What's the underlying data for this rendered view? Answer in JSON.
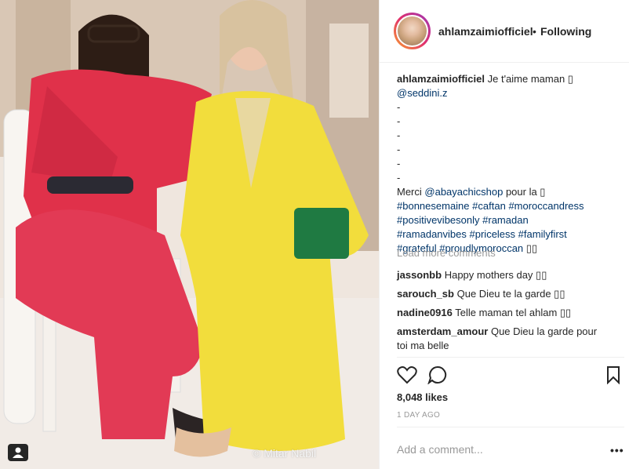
{
  "post": {
    "username": "ahlamzaimiofficiel",
    "separator": "•",
    "follow_status": "Following",
    "caption": {
      "username": "ahlamzaimiofficiel",
      "text_line1": "Je t'aime maman ▯",
      "mention1": "@seddini.z",
      "dashes": [
        "-",
        "-",
        "-",
        "-",
        "-",
        "-"
      ],
      "merci_pre": "Merci ",
      "mention2": "@abayachicshop",
      "merci_post": " pour la ▯",
      "hashtags": [
        "#bonnesemaine",
        "#caftan",
        "#moroccandress",
        "#positivevibesonly",
        "#ramadan",
        "#ramadanvibes",
        "#priceless",
        "#familyfirst",
        "#grateful",
        "#proudlymoroccan"
      ],
      "end": "▯▯"
    },
    "load_more": "Load more comments",
    "comments": [
      {
        "user": "jassonbb",
        "text": "Happy mothers day ▯▯"
      },
      {
        "user": "sarouch_sb",
        "text": "Que Dieu te la garde ▯▯"
      },
      {
        "user": "nadine0916",
        "text": "Telle maman tel ahlam ▯▯"
      },
      {
        "user": "amsterdam_amour",
        "text": "Que Dieu la garde pour toi ma belle"
      }
    ],
    "likes": "8,048 likes",
    "time": "1 DAY AGO",
    "add_comment_placeholder": "Add a comment...",
    "more_label": "•••",
    "watermark": "© Mitar Nabil"
  },
  "icons": {
    "like": "heart-icon",
    "comment": "comment-icon",
    "save": "bookmark-icon",
    "tagged": "user-tag-icon"
  },
  "colors": {
    "link": "#003569",
    "muted": "#999999",
    "text": "#262626",
    "dress_left": "#e0314a",
    "dress_right": "#f2dd3c"
  }
}
